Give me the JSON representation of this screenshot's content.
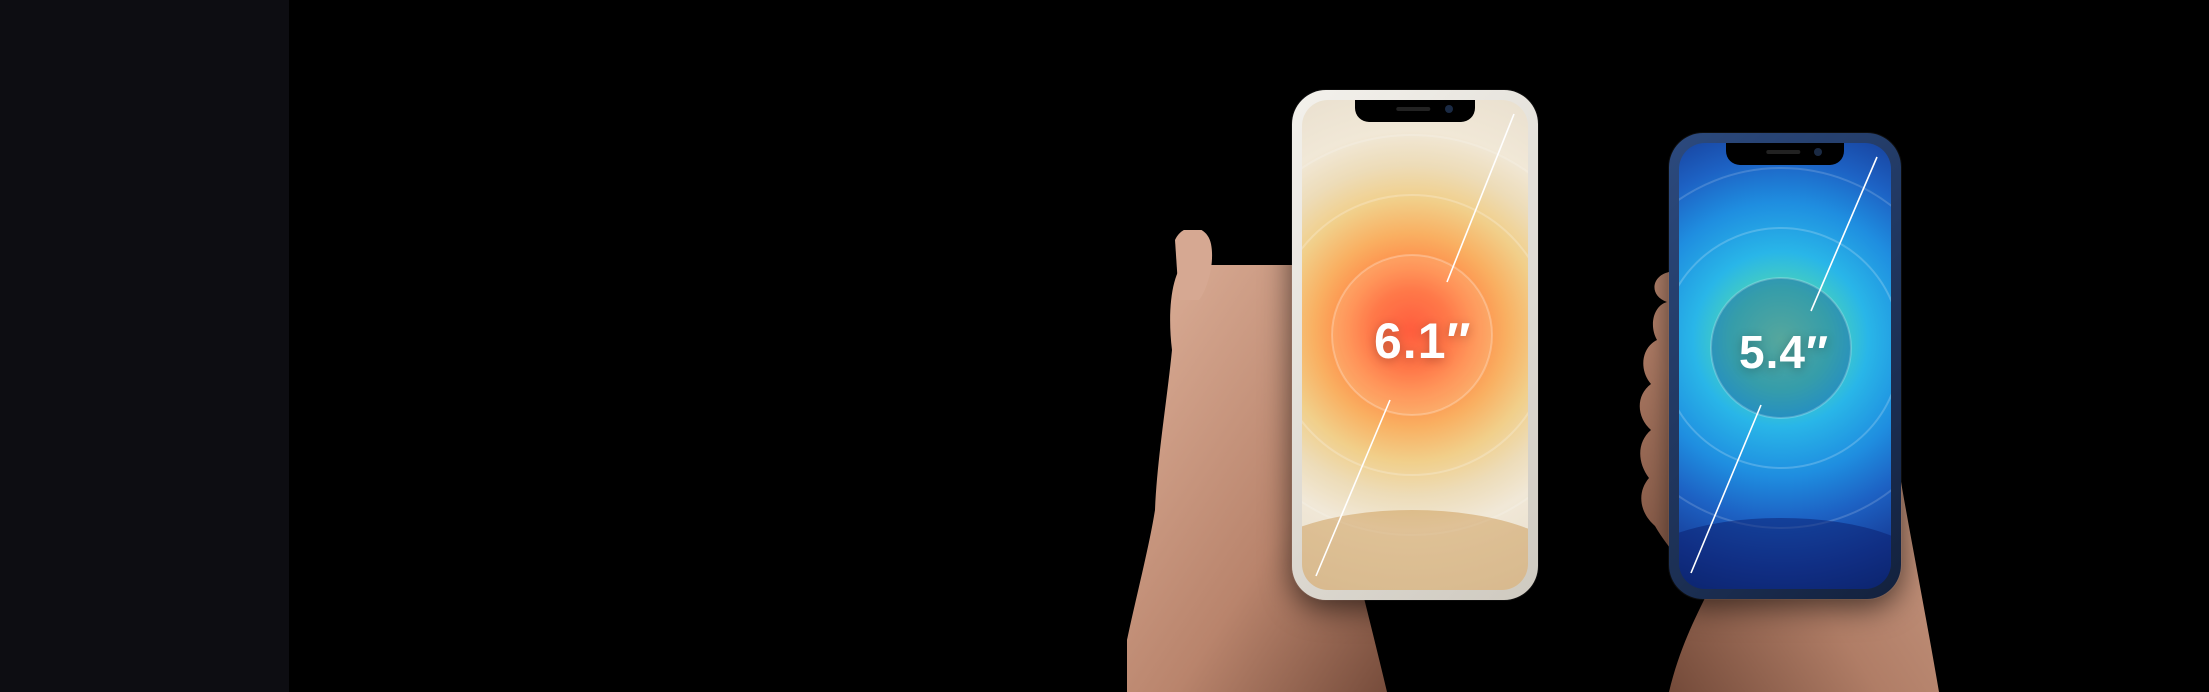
{
  "phones": {
    "large": {
      "size_label": "6.1″",
      "frame_color": "#e9e6df",
      "accent": "#ff5a2a"
    },
    "small": {
      "size_label": "5.4″",
      "frame_color": "#1d2f52",
      "accent": "#31b6f0"
    }
  },
  "colors": {
    "background": "#000000",
    "left_panel": "#0d0d12",
    "skin": "#c99a83"
  }
}
